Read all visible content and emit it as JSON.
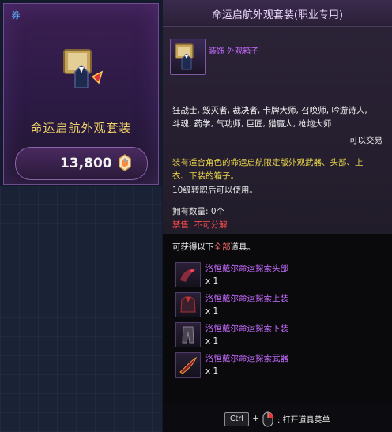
{
  "card": {
    "badge": "券",
    "title": "命运启航外观套装",
    "price": "13,800",
    "icon": "costume-box-icon",
    "currency_icon": "gem-icon"
  },
  "tooltip": {
    "header_title": "命运启航外观套装(职业专用)",
    "item_name": "装饰 外观箱子",
    "classes_line1": "狂战士, 毁灭者, 裁决者, 卡牌大师, 召唤师, 吟游诗人,",
    "classes_line2": "斗魂, 药学, 气功师, 巨匠, 猎魔人, 枪炮大师",
    "tradable": "可以交易",
    "desc_line1": "装有适合角色的命运启航限定版外观武器、头部、上",
    "desc_line2": "衣、下装的箱子。",
    "level_req": "10级转职后可以使用。",
    "owned": "拥有数量: 0个",
    "restriction_a": "禁售",
    "restriction_b": ", 不可分解",
    "obtain_prefix": "可获得以下",
    "obtain_highlight": "全部",
    "obtain_suffix": "道具。",
    "rewards": [
      {
        "name": "洛恒戴尔命运探索头部",
        "qty": "x 1",
        "icon": "helmet-icon"
      },
      {
        "name": "洛恒戴尔命运探索上装",
        "qty": "x 1",
        "icon": "top-armor-icon"
      },
      {
        "name": "洛恒戴尔命运探索下装",
        "qty": "x 1",
        "icon": "pants-icon"
      },
      {
        "name": "洛恒戴尔命运探索武器",
        "qty": "x 1",
        "icon": "weapon-icon"
      }
    ]
  },
  "footer": {
    "ctrl_label": "Ctrl",
    "plus": "+",
    "hint": ": 打开道具菜单"
  },
  "colors": {
    "accent_purple": "#c56bff",
    "desc_yellow": "#e7d34a",
    "warning_red": "#ff4d4d",
    "gold_title": "#f0d36a"
  }
}
